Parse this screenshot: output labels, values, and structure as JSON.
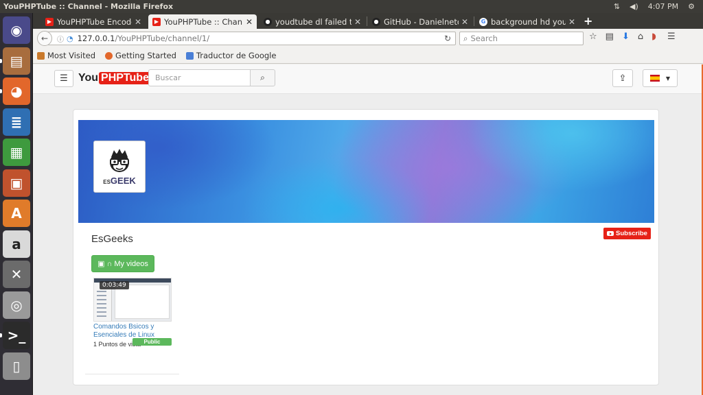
{
  "panel": {
    "window_title": "YouPHPTube :: Channel - Mozilla Firefox",
    "clock": "4:07 PM"
  },
  "launcher": {
    "items": [
      {
        "name": "ubuntu-dash-icon",
        "color": "#4a4a8a",
        "glyph": "◉"
      },
      {
        "name": "files-icon",
        "color": "#a86d3e",
        "glyph": "▤"
      },
      {
        "name": "firefox-icon",
        "color": "#e2672b",
        "glyph": "◕"
      },
      {
        "name": "writer-icon",
        "color": "#2f6fb3",
        "glyph": "≣"
      },
      {
        "name": "calc-icon",
        "color": "#3e9a3e",
        "glyph": "▦"
      },
      {
        "name": "impress-icon",
        "color": "#c0522d",
        "glyph": "▣"
      },
      {
        "name": "software-center-icon",
        "color": "#e07b2a",
        "glyph": "A"
      },
      {
        "name": "amazon-icon",
        "color": "#d9d9d9",
        "glyph": "a"
      },
      {
        "name": "settings-icon",
        "color": "#6b6b6b",
        "glyph": "✕"
      },
      {
        "name": "camera-icon",
        "color": "#9a9a9a",
        "glyph": "◎"
      },
      {
        "name": "terminal-icon",
        "color": "#2b2b2b",
        "glyph": ">_"
      },
      {
        "name": "usb-drive-icon",
        "color": "#8d8d8d",
        "glyph": "▯"
      }
    ]
  },
  "browser": {
    "tabs": [
      {
        "label": "YouPHPTube Encoder",
        "favicon": "youtube-icon",
        "favicon_color": "#e62117",
        "active": false
      },
      {
        "label": "YouPHPTube :: Channel",
        "favicon": "youtube-icon",
        "favicon_color": "#e62117",
        "active": true
      },
      {
        "label": "youdtube dl failed to e",
        "favicon": "github-icon",
        "favicon_color": "#222222",
        "active": false
      },
      {
        "label": "GitHub - DanielnetoDo",
        "favicon": "github-icon",
        "favicon_color": "#222222",
        "active": false
      },
      {
        "label": "background hd youtub",
        "favicon": "google-icon",
        "favicon_color": "#4285f4",
        "active": false
      }
    ],
    "url_host": "127.0.0.1",
    "url_path": "/YouPHPTube/channel/1/",
    "search_placeholder": "Search",
    "bookmarks": [
      {
        "label": "Most Visited",
        "icon": "folder-icon",
        "color": "#c9792b"
      },
      {
        "label": "Getting Started",
        "icon": "firefox-icon",
        "color": "#e2672b"
      },
      {
        "label": "Traductor de Google",
        "icon": "translate-icon",
        "color": "#4a7fd6"
      }
    ]
  },
  "site": {
    "logo_you": "You",
    "logo_tube": "PHPTube",
    "search_placeholder": "Buscar",
    "channel": {
      "avatar_brand_small": "ES",
      "avatar_brand": "GEEK",
      "name": "EsGeeks",
      "subscribe_label": "Subscribe",
      "my_videos_label": "My videos"
    },
    "videos": [
      {
        "duration": "0:03:49",
        "title": "Comandos Bsicos y Esenciales de Linux",
        "views": "1 Puntos de vista",
        "status": "Public"
      }
    ]
  },
  "colors": {
    "brand_red": "#e62117",
    "success_green": "#5cb85c",
    "link_blue": "#337ab7"
  }
}
